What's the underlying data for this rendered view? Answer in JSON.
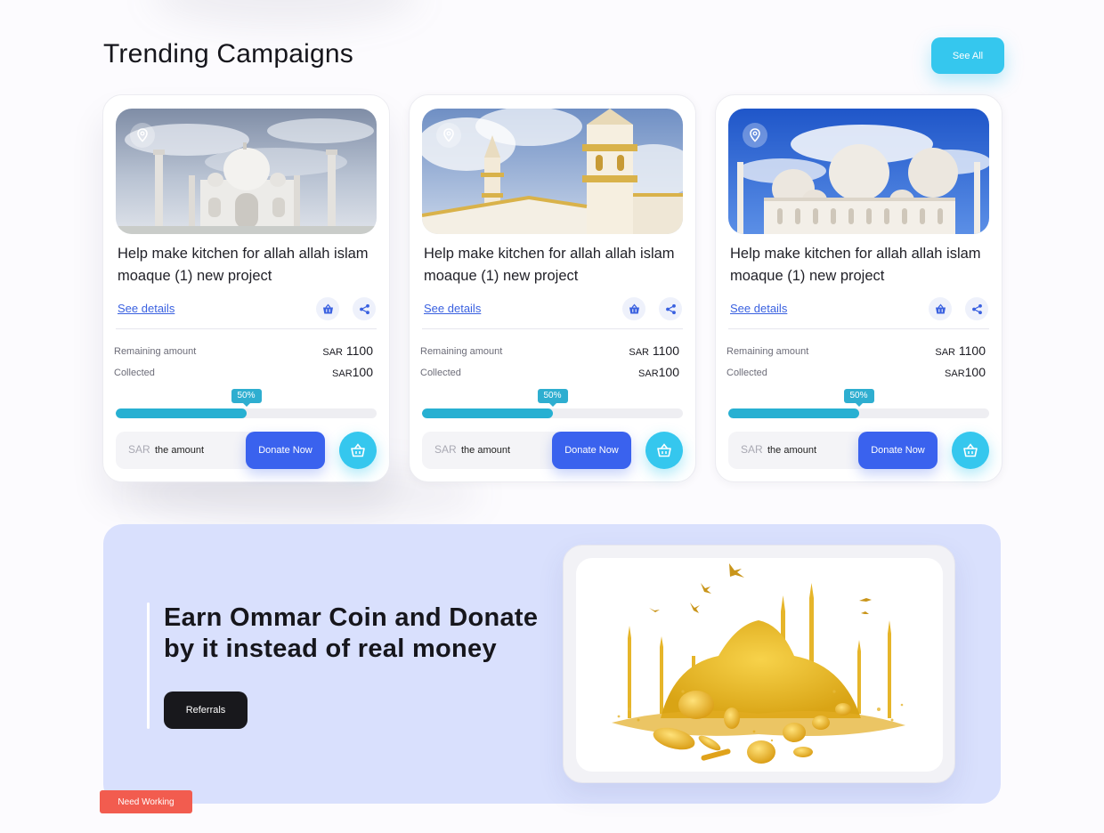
{
  "section": {
    "title": "Trending Campaigns",
    "see_all_label": "See All"
  },
  "cards": [
    {
      "image": "taj-mahal-photo",
      "title": "Help make kitchen for allah allah islam moaque (1) new project",
      "see_details": "See details",
      "remaining_label": "Remaining amount",
      "remaining_currency": "SAR",
      "remaining_value": "1100",
      "collected_label": "Collected",
      "collected_currency": "SAR",
      "collected_value": "100",
      "progress_label": "50%",
      "progress": 0.5,
      "currency": "SAR",
      "amount_placeholder": "the amount",
      "donate_label": "Donate Now"
    },
    {
      "image": "minaret-photo",
      "title": "Help make kitchen for allah allah islam moaque (1) new project",
      "see_details": "See details",
      "remaining_label": "Remaining amount",
      "remaining_currency": "SAR",
      "remaining_value": "1100",
      "collected_label": "Collected",
      "collected_currency": "SAR",
      "collected_value": "100",
      "progress_label": "50%",
      "progress": 0.5,
      "currency": "SAR",
      "amount_placeholder": "the amount",
      "donate_label": "Donate Now"
    },
    {
      "image": "grand-mosque-photo",
      "title": "Help make kitchen for allah allah islam moaque (1) new project",
      "see_details": "See details",
      "remaining_label": "Remaining amount",
      "remaining_currency": "SAR",
      "remaining_value": "1100",
      "collected_label": "Collected",
      "collected_currency": "SAR",
      "collected_value": "100",
      "progress_label": "50%",
      "progress": 0.5,
      "currency": "SAR",
      "amount_placeholder": "the amount",
      "donate_label": "Donate Now"
    }
  ],
  "promo": {
    "title": "Earn Ommar Coin and Donate by it instead of real money",
    "button_label": "Referrals",
    "image": "gold-mosque-coins-illustration"
  },
  "badge": {
    "label": "Need Working"
  },
  "icons": {
    "pin": "location-pin-icon",
    "basket": "basket-icon",
    "share": "share-icon",
    "cart": "cart-icon"
  },
  "colors": {
    "accent_cyan": "#35c7ee",
    "primary_blue": "#3a62ee",
    "progress": "#27b0d2",
    "promo_bg": "#d9e0fd",
    "dark_button": "#18181c",
    "warning": "#f25c4f"
  }
}
